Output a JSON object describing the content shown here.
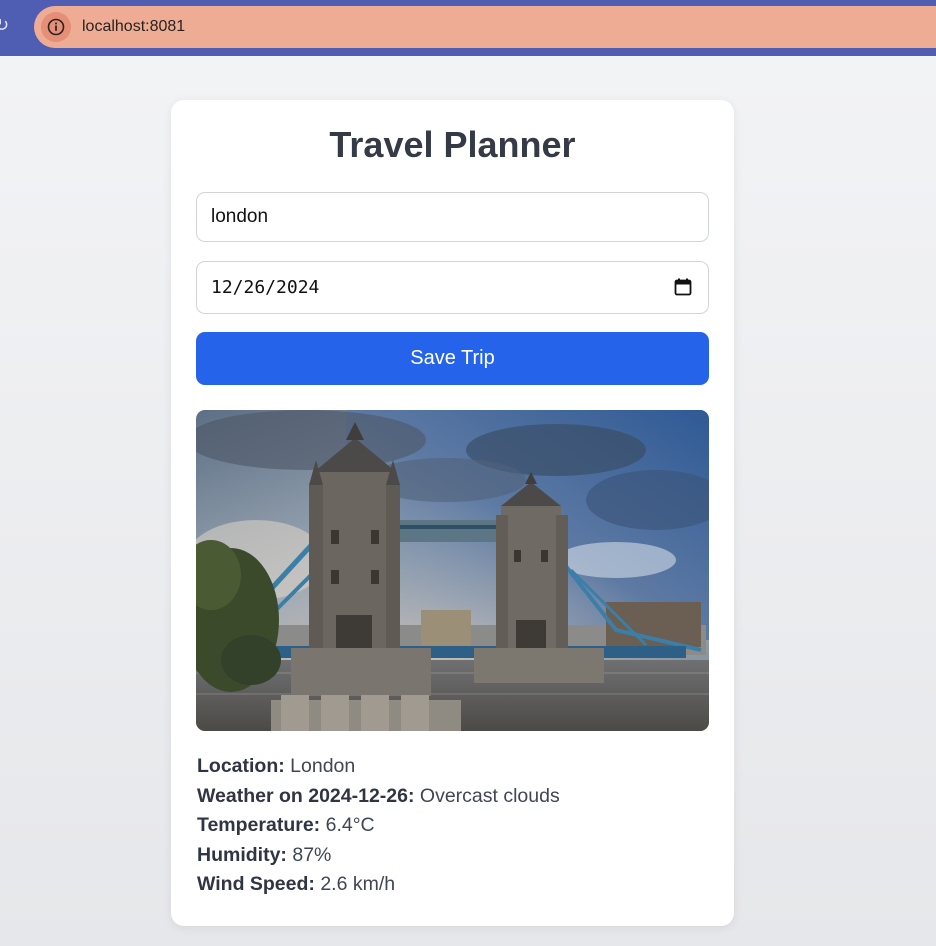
{
  "browser": {
    "url": "localhost:8081"
  },
  "app": {
    "title": "Travel Planner"
  },
  "form": {
    "city_value": "london",
    "date_value": "12/26/2024",
    "save_label": "Save Trip"
  },
  "details": {
    "location_label": "Location:",
    "location_value": "London",
    "weather_label": "Weather on 2024-12-26:",
    "weather_value": "Overcast clouds",
    "temperature_label": "Temperature:",
    "temperature_value": "6.4°C",
    "humidity_label": "Humidity:",
    "humidity_value": "87%",
    "wind_label": "Wind Speed:",
    "wind_value": "2.6 km/h"
  },
  "colors": {
    "topbar": "#4f5db3",
    "urlbar": "#edac93",
    "accent": "#2563eb",
    "title": "#343a46"
  },
  "icons": {
    "reload": "reload-icon",
    "info": "info-icon",
    "calendar": "calendar-icon"
  }
}
